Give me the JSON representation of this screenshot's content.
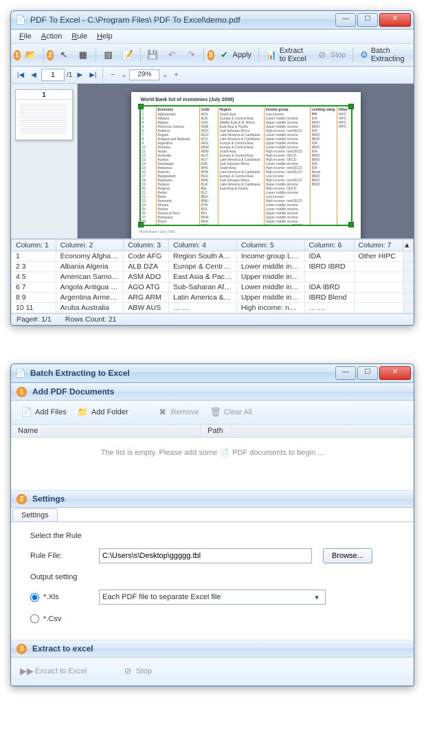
{
  "win1": {
    "title": "PDF To Excel - C:\\Program Files\\   PDF To Excel\\demo.pdf",
    "menu": [
      "File",
      "Action",
      "Rule",
      "Help"
    ],
    "toolbar": {
      "apply": "Apply",
      "extract": "Extract to Excel",
      "stop": "Stop",
      "batch": "Batch Extracting"
    },
    "pager": {
      "page": "1",
      "total": "/1",
      "zoom": "29%"
    },
    "thumb_num": "1",
    "page_title": "World Bank list of economies (July 2008)",
    "page_footnote": "World Bank • July 2008",
    "doc_headers": [
      "",
      "Economy",
      "Code",
      "Region",
      "Income group",
      "Lending category",
      "Other"
    ],
    "doc_sample": {
      "c1": [
        "1",
        "2",
        "3",
        "4",
        "5",
        "6",
        "7",
        "8",
        "9",
        "10",
        "11",
        "12",
        "13",
        "14",
        "15",
        "16",
        "17",
        "18",
        "19",
        "20",
        "21",
        "22",
        "23",
        "24",
        "25",
        "26",
        "27",
        "28"
      ],
      "c2": [
        "Afghanistan",
        "Albania",
        "Algeria",
        "American Samoa",
        "Andorra",
        "Angola",
        "Antigua and Barbuda",
        "Argentina",
        "Armenia",
        "Aruba",
        "Australia",
        "Austria",
        "Azerbaijan",
        "Bahamas",
        "Bahrain",
        "Bangladesh",
        "Barbados",
        "Belarus",
        "Belgium",
        "Belize",
        "Benin",
        "Bermuda",
        "Bhutan",
        "Bolivia",
        "Bosnia & Herz.",
        "Botswana",
        "Brazil",
        "Brunei"
      ],
      "c3": [
        "AFG",
        "ALB",
        "DZA",
        "ASM",
        "ADO",
        "AGO",
        "ATG",
        "ARG",
        "ARM",
        "ABW",
        "AUS",
        "AUT",
        "AZE",
        "BHS",
        "BHR",
        "BGD",
        "BRB",
        "BLR",
        "BEL",
        "BLZ",
        "BEN",
        "BMU",
        "BTN",
        "BOL",
        "BIH",
        "BWA",
        "BRA",
        "BRN"
      ],
      "c4": [
        "South Asia",
        "Europe & Central Asia",
        "Middle East & N. Africa",
        "East Asia & Pacific",
        "",
        "Sub-Saharan Africa",
        "Latin America & Caribbean",
        "Latin America & Caribbean",
        "Europe & Central Asia",
        "",
        "",
        "",
        "Europe & Central Asia",
        "",
        "",
        "South Asia",
        "",
        "Europe & Central Asia",
        "",
        "Latin America & Caribbean",
        "Sub-Saharan Africa",
        "",
        "South Asia",
        "Latin America & Caribbean",
        "Europe & Central Asia",
        "Sub-Saharan Africa",
        "Latin America & Caribbean",
        "East Asia & Pacific"
      ],
      "c5": [
        "Low income",
        "Lower middle income",
        "Upper middle income",
        "Upper middle income",
        "High income: nonOECD",
        "Lower middle income",
        "Upper middle income",
        "Upper middle income",
        "Lower middle income",
        "High income: nonOECD",
        "High income: OECD",
        "High income: OECD",
        "Lower middle income",
        "High income: nonOECD",
        "High income: nonOECD",
        "Low income",
        "High income: nonOECD",
        "Upper middle income",
        "High income: OECD",
        "Lower middle income",
        "Low income",
        "High income: nonOECD",
        "Lower middle income",
        "Lower middle income",
        "Upper middle income",
        "Upper middle income",
        "Upper middle income",
        "High income: nonOECD"
      ],
      "c6": [
        "IDA",
        "IBRD",
        "IBRD",
        "",
        "",
        "IDA",
        "IBRD",
        "IBRD",
        "IDA",
        "",
        "",
        "",
        "IBRD",
        "",
        "",
        "IDA",
        "",
        "IBRD",
        "",
        "IBRD",
        "IDA",
        "",
        "IDA",
        "Blend",
        "IBRD",
        "IBRD",
        "IBRD",
        ""
      ],
      "c7": [
        "HIPC",
        "",
        "",
        "",
        "",
        "HIPC",
        "",
        "",
        "",
        "",
        "",
        "",
        "",
        "",
        "",
        "",
        "",
        "",
        "",
        "",
        "HIPC",
        "",
        "",
        "HIPC",
        "",
        "",
        "",
        ""
      ]
    },
    "grid": {
      "headers": [
        "Column: 1",
        "Column: 2",
        "Column: 3",
        "Column: 4",
        "Column: 5",
        "Column: 6",
        "Column: 7"
      ],
      "rows": [
        [
          "1",
          "Economy Afgha…",
          "Code AFG",
          "Region South Asia",
          "Income group L…",
          "IDA",
          "Other HIPC"
        ],
        [
          "2 3",
          "Albania Algeria",
          "ALB DZA",
          "Europe & Centr…",
          "Lower middle in…",
          "IBRD IBRD",
          ""
        ],
        [
          "4 5",
          "American Samo…",
          "ASM ADO",
          "East Asia & Paci…",
          "Upper middle in…",
          "",
          ""
        ],
        [
          "6 7",
          "Angola Antigua …",
          "AGO ATG",
          "Sub-Saharan Af…",
          "Lower middle in…",
          "IDA IBRD",
          ""
        ],
        [
          "8 9",
          "Argentina Arme…",
          "ARG ARM",
          "Latin America &…",
          "Upper middle in…",
          "IBRD Blend",
          ""
        ],
        [
          "10 11",
          "Aruba Australia",
          "ABW AUS",
          "… …",
          "High income: no…",
          "… …",
          ""
        ]
      ]
    },
    "status": {
      "page": "Page#: 1/1",
      "rows": "Rows Count: 21"
    }
  },
  "win2": {
    "title": "Batch Extracting to Excel",
    "sec1": "Add PDF Documents",
    "btns": {
      "add_files": "Add Files",
      "add_folder": "Add Folder",
      "remove": "Remove",
      "clear": "Clear All"
    },
    "list": {
      "h1": "Name",
      "h2": "Path",
      "empty_a": "The list is empty. Please add some",
      "empty_b": "PDF documents to begin ..."
    },
    "sec2": "Settings",
    "tab": "Settings",
    "select_rule": "Select the Rule",
    "rule_file_label": "Rule File:",
    "rule_file_value": "C:\\Users\\s\\Desktop\\ggggg.tbl",
    "browse": "Browse...",
    "output_setting": "Output setting",
    "xls": "*.Xls",
    "csv": "*.Csv",
    "output_mode": "Each PDF file to separate Excel file",
    "sec3": "Extract to excel",
    "exact": "Excact to Excel",
    "stop": "Stop"
  }
}
